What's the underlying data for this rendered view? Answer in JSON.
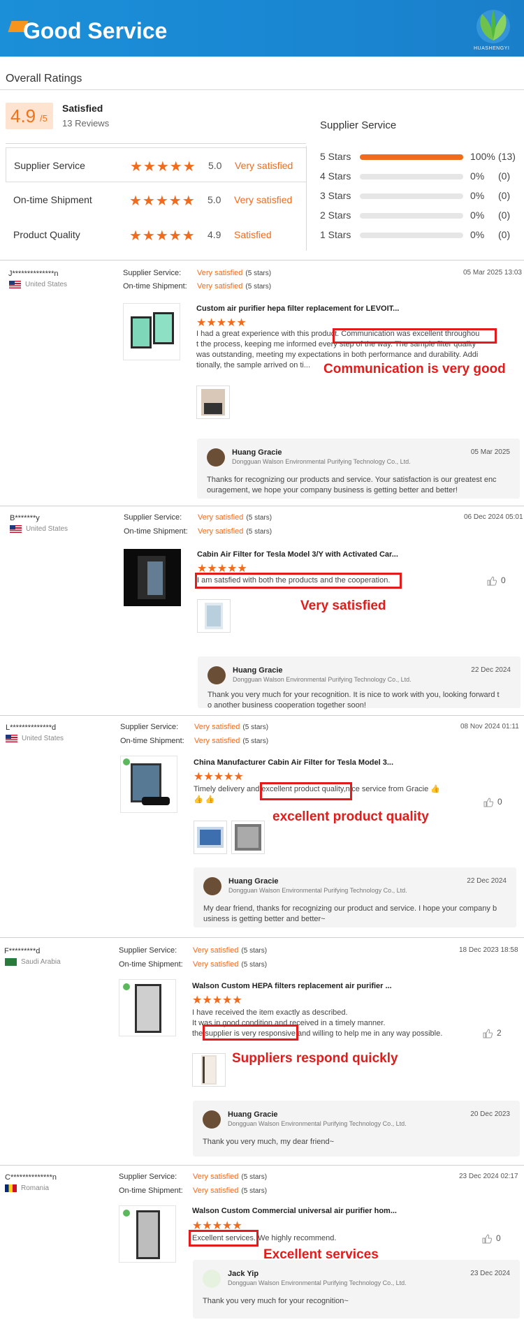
{
  "banner": {
    "title": "Good Service",
    "logo_text": "HUASHENGYI"
  },
  "overall": {
    "title": "Overall Ratings",
    "score": "4.9",
    "out_of": "/5",
    "satisfaction": "Satisfied",
    "reviews": "13 Reviews",
    "rows": [
      {
        "label": "Supplier Service",
        "value": "5.0",
        "text": "Very satisfied",
        "stars": "★★★★★"
      },
      {
        "label": "On-time Shipment",
        "value": "5.0",
        "text": "Very satisfied",
        "stars": "★★★★★"
      },
      {
        "label": "Product Quality",
        "value": "4.9",
        "text": "Satisfied",
        "stars": "★★★★★"
      }
    ]
  },
  "distribution": {
    "title": "Supplier Service",
    "rows": [
      {
        "label": "5  Stars",
        "pct": "100%",
        "count": "(13)",
        "fraction": 1.0
      },
      {
        "label": "4  Stars",
        "pct": "0%",
        "count": "(0)",
        "fraction": 0
      },
      {
        "label": "3  Stars",
        "pct": "0%",
        "count": "(0)",
        "fraction": 0
      },
      {
        "label": "2  Stars",
        "pct": "0%",
        "count": "(0)",
        "fraction": 0
      },
      {
        "label": "1  Stars",
        "pct": "0%",
        "count": "(0)",
        "fraction": 0
      }
    ]
  },
  "labels": {
    "supplier_service": "Supplier Service:",
    "ontime_shipment": "On-time Shipment:",
    "very_satisfied": "Very satisfied",
    "five_stars": "(5 stars)",
    "stars": "★★★★★"
  },
  "reviews": [
    {
      "user": "J**************n",
      "country": "United States",
      "date": "05 Mar 2025 13:03",
      "product": "Custom air purifier hepa filter replacement for LEVOIT...",
      "comment_l1": "I had a great experience with this product. Communication was excellent throughou",
      "comment_l2": "t the process, keeping me informed every step of the way. The sample filter quality",
      "comment_l3": "was outstanding, meeting my expectations in both performance and durability. Addi",
      "comment_l4": "tionally, the sample arrived on ti...",
      "likes": "",
      "callout": "Communication is very good",
      "reply": {
        "name": "Huang Gracie",
        "company": "Dongguan Walson Environmental Purifying Technology Co., Ltd.",
        "date": "05 Mar 2025",
        "l1": "Thanks for recognizing our products and service. Your satisfaction is our greatest enc",
        "l2": "ouragement, we hope your company business is getting better and better!"
      }
    },
    {
      "user": "B*******y",
      "country": "United States",
      "date": "06 Dec 2024 05:01",
      "product": "Cabin Air Filter for Tesla Model 3/Y with Activated Car...",
      "comment_l1": "I am satsfied with both the products and the cooperation.",
      "likes": "0",
      "callout": "Very satisfied",
      "reply": {
        "name": "Huang Gracie",
        "company": "Dongguan Walson Environmental Purifying Technology Co., Ltd.",
        "date": "22 Dec 2024",
        "l1": "Thank you very much for your recognition. It is nice to work with you, looking forward t",
        "l2": "o another business cooperation together soon!"
      }
    },
    {
      "user": "L**************d",
      "country": "United States",
      "date": "08 Nov 2024 01:11",
      "product": "China Manufacturer Cabin Air Filter for Tesla Model 3...",
      "comment_l1": "Timely delivery and excellent product quality,nice service from Gracie 👍",
      "comment_l2": "👍 👍",
      "likes": "0",
      "callout": "excellent product quality",
      "reply": {
        "name": "Huang Gracie",
        "company": "Dongguan Walson Environmental Purifying Technology Co., Ltd.",
        "date": "22 Dec 2024",
        "l1": "My dear friend, thanks for recognizing our product and service. I hope your company b",
        "l2": "usiness is getting better and better~"
      }
    },
    {
      "user": "F*********d",
      "country": "Saudi Arabia",
      "date": "18 Dec 2023 18:58",
      "product": "Walson Custom HEPA filters replacement air purifier ...",
      "comment_l1": "I have received the item exactly as described.",
      "comment_l2": "It was in good condition and received in a timely manner.",
      "comment_l3": "the supplier is very responsive and willing to help me in any way possible.",
      "likes": "2",
      "callout": "Suppliers respond quickly",
      "reply": {
        "name": "Huang Gracie",
        "company": "Dongguan Walson Environmental Purifying Technology Co., Ltd.",
        "date": "20 Dec 2023",
        "l1": "Thank you very much, my dear friend~",
        "l2": ""
      }
    },
    {
      "user": "C**************n",
      "country": "Romania",
      "date": "23 Dec 2024 02:17",
      "product": "Walson Custom Commercial universal air purifier hom...",
      "comment_l1": "Excellent services. We highly recommend.",
      "likes": "0",
      "callout": "Excellent services",
      "reply": {
        "name": "Jack Yip",
        "company": "Dongguan Walson Environmental Purifying Technology Co., Ltd.",
        "date": "23 Dec 2024",
        "l1": "Thank you very much for your recognition~",
        "l2": ""
      }
    }
  ]
}
